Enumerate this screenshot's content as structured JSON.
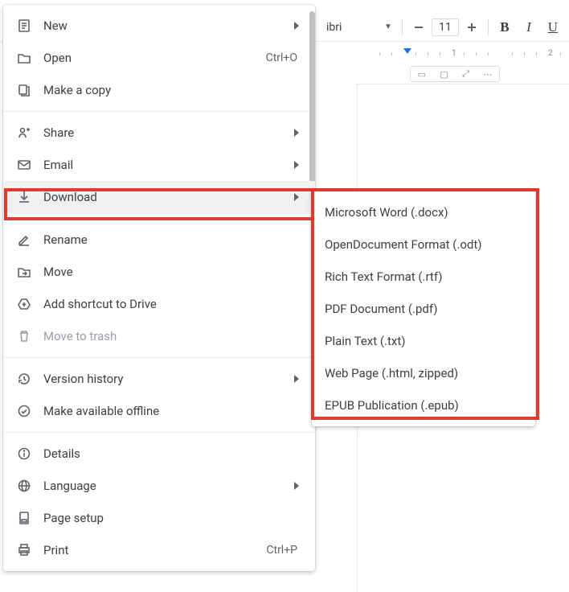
{
  "toolbar": {
    "font_name": "ibri",
    "font_size": "11",
    "ruler": {
      "n1": "1",
      "n2": "2"
    }
  },
  "menu": {
    "new": "New",
    "open": "Open",
    "open_shortcut": "Ctrl+O",
    "make_copy": "Make a copy",
    "share": "Share",
    "email": "Email",
    "download": "Download",
    "rename": "Rename",
    "move": "Move",
    "add_shortcut": "Add shortcut to Drive",
    "move_to_trash": "Move to trash",
    "version_history": "Version history",
    "offline": "Make available offline",
    "details": "Details",
    "language": "Language",
    "page_setup": "Page setup",
    "print": "Print",
    "print_shortcut": "Ctrl+P"
  },
  "submenu": {
    "docx": "Microsoft Word (.docx)",
    "odt": "OpenDocument Format (.odt)",
    "rtf": "Rich Text Format (.rtf)",
    "pdf": "PDF Document (.pdf)",
    "txt": "Plain Text (.txt)",
    "html": "Web Page (.html, zipped)",
    "epub": "EPUB Publication (.epub)"
  }
}
